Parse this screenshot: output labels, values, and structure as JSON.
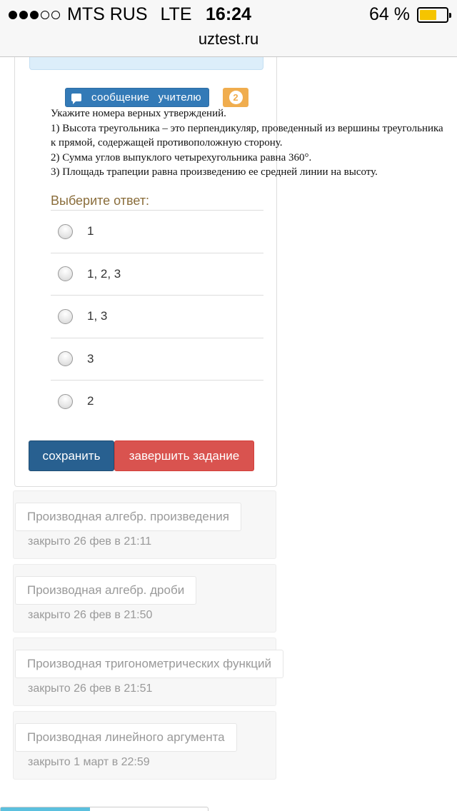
{
  "status_bar": {
    "carrier": "MTS RUS",
    "network": "LTE",
    "time": "16:24",
    "battery_percent": "64 %",
    "battery_level": 0.64,
    "signal_bars_filled": 3,
    "signal_bars_total": 5
  },
  "browser": {
    "url": "uztest.ru"
  },
  "question_card": {
    "message_button_label": "сообщение учителю",
    "badge_count": "2",
    "question_lines": [
      "Укажите номера верных утверждений.",
      "1) Высота треугольника – это перпендикуляр, проведенный из вершины треугольника",
      "к прямой, содержащей противоположную сторону.",
      "2) Сумма углов выпуклого четырехугольника равна 360°.",
      "3) Площадь трапеции равна произведению ее средней линии на высоту."
    ],
    "choose_label": "Выберите ответ:",
    "options": [
      "1",
      "1, 2, 3",
      "1, 3",
      "3",
      "2"
    ],
    "save_label": "сохранить",
    "finish_label": "завершить задание"
  },
  "closed_tasks": [
    {
      "title": "Производная алгебр. произведения",
      "status": "закрыто 26 фев в 21:11"
    },
    {
      "title": "Производная алгебр. дроби",
      "status": "закрыто 26 фев в 21:50"
    },
    {
      "title": "Производная тригонометрических функций",
      "status": "закрыто 26 фев в 21:51"
    },
    {
      "title": "Производная линейного аргумента",
      "status": "закрыто 1 март в 22:59"
    }
  ],
  "colors": {
    "primary": "#337ab7",
    "save": "#286090",
    "danger": "#d9534f",
    "badge": "#f0ad4e",
    "choose_label": "#8a6d3b",
    "battery": "#f5c400"
  }
}
